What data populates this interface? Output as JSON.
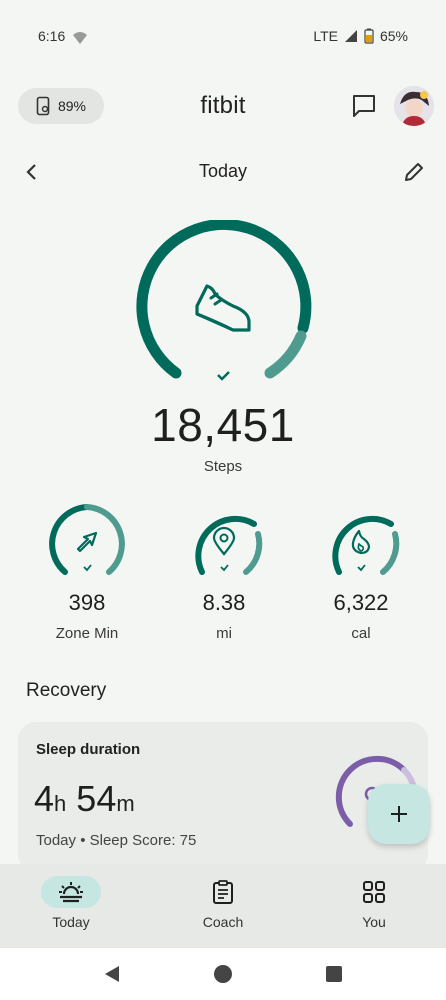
{
  "status": {
    "time": "6:16",
    "network": "LTE",
    "battery": "65%"
  },
  "header": {
    "device_battery": "89%",
    "title": "fitbit"
  },
  "subheader": {
    "title": "Today"
  },
  "steps": {
    "value": "18,451",
    "label": "Steps",
    "progress": 0.82
  },
  "metrics": [
    {
      "value": "398",
      "label": "Zone Min",
      "icon": "zone-arrow-icon"
    },
    {
      "value": "8.38",
      "label": "mi",
      "icon": "location-pin-icon"
    },
    {
      "value": "6,322",
      "label": "cal",
      "icon": "flame-icon"
    }
  ],
  "recovery": {
    "title": "Recovery",
    "card_title": "Sleep duration",
    "hours": "4",
    "hours_unit": "h",
    "minutes": "54",
    "minutes_unit": "m",
    "subtitle": "Today • Sleep Score: 75"
  },
  "nav": [
    {
      "label": "Today",
      "icon": "today-sunrise-icon",
      "active": true
    },
    {
      "label": "Coach",
      "icon": "clipboard-icon",
      "active": false
    },
    {
      "label": "You",
      "icon": "grid-icon",
      "active": false
    }
  ],
  "colors": {
    "accent": "#006a5b",
    "accent_light": "#4f9b8f",
    "sleep": "#7b5ea7",
    "background": "#f4f6f3"
  }
}
